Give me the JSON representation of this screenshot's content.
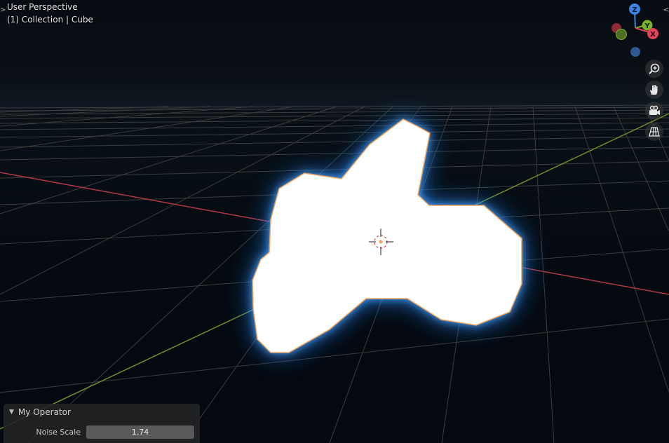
{
  "viewport": {
    "view_mode": "User Perspective",
    "active_object": "(1) Collection | Cube"
  },
  "gizmo": {
    "z_label": "Z",
    "y_label": "Y",
    "x_label": "X",
    "colors": {
      "x": "#e0445c",
      "y": "#7ab32c",
      "z": "#3b85e0",
      "neg_x": "#8e2a39",
      "neg_y": "#4d7020",
      "neg_z": "#2d5a90"
    }
  },
  "nav_buttons": [
    {
      "icon": "zoom-icon"
    },
    {
      "icon": "hand-pan-icon"
    },
    {
      "icon": "camera-icon"
    },
    {
      "icon": "ortho-grid-icon"
    }
  ],
  "operator_panel": {
    "title": "My Operator",
    "param_label": "Noise Scale",
    "param_value": "1.74"
  },
  "colors": {
    "x_axis": "#b23a45",
    "y_axis": "#6e8f2c",
    "grid": "#4a4a4a",
    "selection_outline": "#f0a35e",
    "glow": "#2a7fe0"
  }
}
